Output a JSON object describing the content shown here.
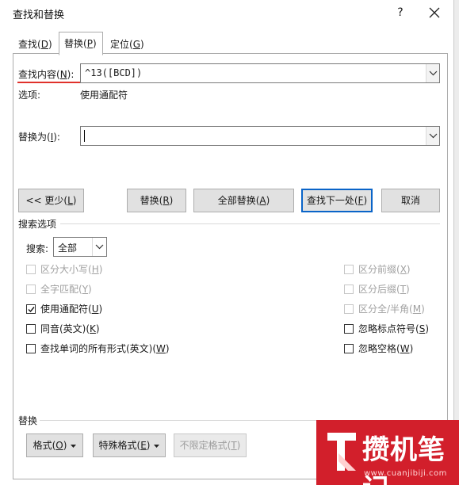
{
  "dialog": {
    "title": "查找和替换",
    "help": "?",
    "tabs": [
      {
        "label": "查找(",
        "key": "D",
        "suffix": ")"
      },
      {
        "label": "替换(",
        "key": "P",
        "suffix": ")"
      },
      {
        "label": "定位(",
        "key": "G",
        "suffix": ")"
      }
    ]
  },
  "find": {
    "label": "查找内容(",
    "key": "N",
    "suffix": "):",
    "value": "^13([BCD])",
    "options_label": "选项:",
    "options_value": "使用通配符"
  },
  "replace": {
    "label": "替换为(",
    "key": "I",
    "suffix": "):",
    "value": ""
  },
  "buttons": {
    "less": {
      "label": "<< 更少(",
      "key": "L",
      "suffix": ")"
    },
    "replace": {
      "label": "替换(",
      "key": "R",
      "suffix": ")"
    },
    "replace_all": {
      "label": "全部替换(",
      "key": "A",
      "suffix": ")"
    },
    "find_next": {
      "label": "查找下一处(",
      "key": "F",
      "suffix": ")"
    },
    "cancel": {
      "label": "取消"
    }
  },
  "search_options": {
    "group_label": "搜索选项",
    "search_label": "搜索:",
    "search_value": "全部",
    "left": [
      {
        "pre": "区分大小写(",
        "key": "H",
        "suf": ")",
        "checked": false,
        "disabled": true
      },
      {
        "pre": "全字匹配(",
        "key": "Y",
        "suf": ")",
        "checked": false,
        "disabled": true
      },
      {
        "pre": "使用通配符(",
        "key": "U",
        "suf": ")",
        "checked": true,
        "disabled": false
      },
      {
        "pre": "同音(英文)(",
        "key": "K",
        "suf": ")",
        "checked": false,
        "disabled": false
      },
      {
        "pre": "查找单词的所有形式(英文)(",
        "key": "W",
        "suf": ")",
        "checked": false,
        "disabled": false
      }
    ],
    "right": [
      {
        "pre": "区分前缀(",
        "key": "X",
        "suf": ")",
        "checked": false,
        "disabled": true
      },
      {
        "pre": "区分后缀(",
        "key": "T",
        "suf": ")",
        "checked": false,
        "disabled": true
      },
      {
        "pre": "区分全/半角(",
        "key": "M",
        "suf": ")",
        "checked": false,
        "disabled": true
      },
      {
        "pre": "忽略标点符号(",
        "key": "S",
        "suf": ")",
        "checked": false,
        "disabled": false
      },
      {
        "pre": "忽略空格(",
        "key": "W",
        "suf": ")",
        "checked": false,
        "disabled": false
      }
    ]
  },
  "replace_section": {
    "group_label": "替换",
    "format": {
      "label": "格式(",
      "key": "O",
      "suffix": ")"
    },
    "special": {
      "label": "特殊格式(",
      "key": "E",
      "suffix": ")"
    },
    "no_format": {
      "label": "不限定格式(",
      "key": "T",
      "suffix": ")"
    }
  },
  "watermark": {
    "text": "攒机笔记",
    "url": "www.cuanjibiji.com"
  },
  "colors": {
    "accent_red": "#e0312b",
    "focus_blue": "#0a64c8",
    "watermark_red": "#d21f2b"
  }
}
